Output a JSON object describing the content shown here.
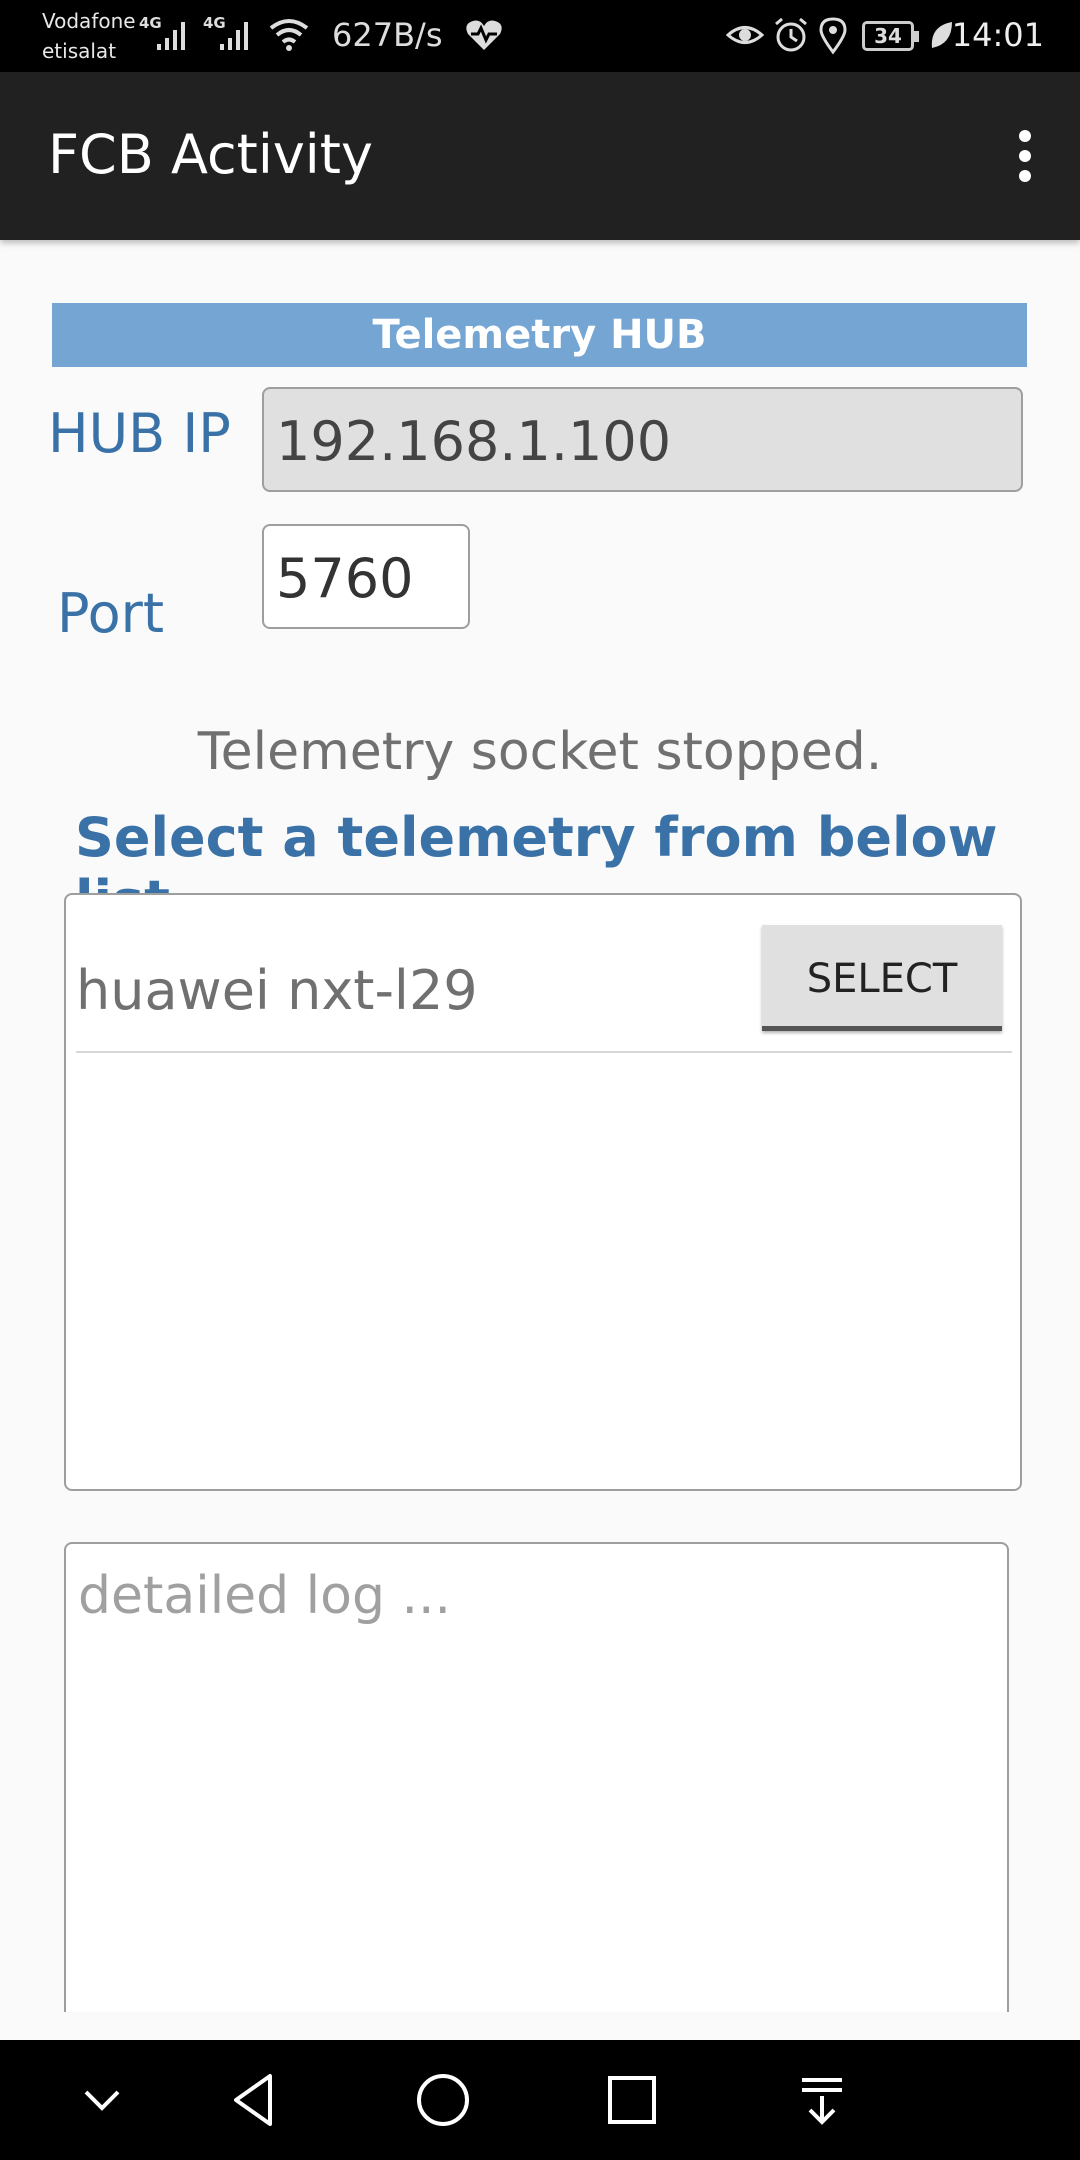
{
  "status_bar": {
    "carrier_line1": "Vodafone",
    "carrier_line2": "etisalat",
    "network_type1": "4G",
    "network_type2": "4G",
    "speed": "627B/s",
    "battery": "34",
    "time": "14:01",
    "icons": [
      "signal-icon",
      "signal-icon",
      "wifi-icon",
      "health-icon",
      "eye-icon",
      "alarm-icon",
      "location-icon",
      "battery-icon",
      "leaf-icon"
    ]
  },
  "appbar": {
    "title": "FCB Activity",
    "menu_icon": "more-vert-icon"
  },
  "hub": {
    "header": "Telemetry HUB",
    "ip_label": "HUB IP",
    "ip_value": "192.168.1.100",
    "port_label": "Port",
    "port_value": "5760"
  },
  "status": {
    "socket_text": "Telemetry socket stopped.",
    "select_heading": "Select a telemetry from below list"
  },
  "telemetry_list": {
    "items": [
      {
        "name": "huawei nxt-l29",
        "button": "SELECT"
      }
    ]
  },
  "log": {
    "placeholder": "detailed log ..."
  },
  "navbar": {
    "buttons": [
      "chevron-down-icon",
      "back-icon",
      "home-icon",
      "recents-icon",
      "notifications-pull-icon"
    ]
  }
}
